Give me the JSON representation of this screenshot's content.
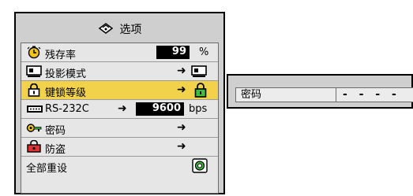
{
  "menu": {
    "title": "选项",
    "rows": [
      {
        "label": "残存率",
        "value": "99",
        "unit": "%"
      },
      {
        "label": "投影模式",
        "arrow": "➜"
      },
      {
        "label": "键锁等级",
        "arrow": "➜",
        "selected": true
      },
      {
        "label": "RS-232C",
        "arrow": "➜",
        "value": "9600",
        "unit": "bps"
      },
      {
        "label": "密码",
        "arrow": "➜"
      },
      {
        "label": "防盗",
        "arrow": "➜"
      },
      {
        "label": "全部重设"
      }
    ]
  },
  "password": {
    "label": "密码",
    "value": "- - - -"
  },
  "colors": {
    "selected_row": "#f2d24a",
    "panel_bg": "#cfcfcf",
    "value_box": "#000000"
  }
}
